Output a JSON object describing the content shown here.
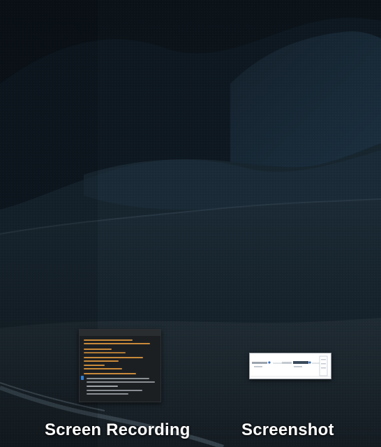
{
  "desktop": {
    "wallpaper": "dark-mountain-landscape",
    "colors": {
      "sky": "#0c141b",
      "hill": "#1a2d3c",
      "ground": "#1e2a33",
      "label": "#ffffff"
    }
  },
  "files": [
    {
      "label": "Screen Recording",
      "icon": "video-thumbnail-icon"
    },
    {
      "label": "Screenshot",
      "icon": "image-thumbnail-icon"
    }
  ]
}
